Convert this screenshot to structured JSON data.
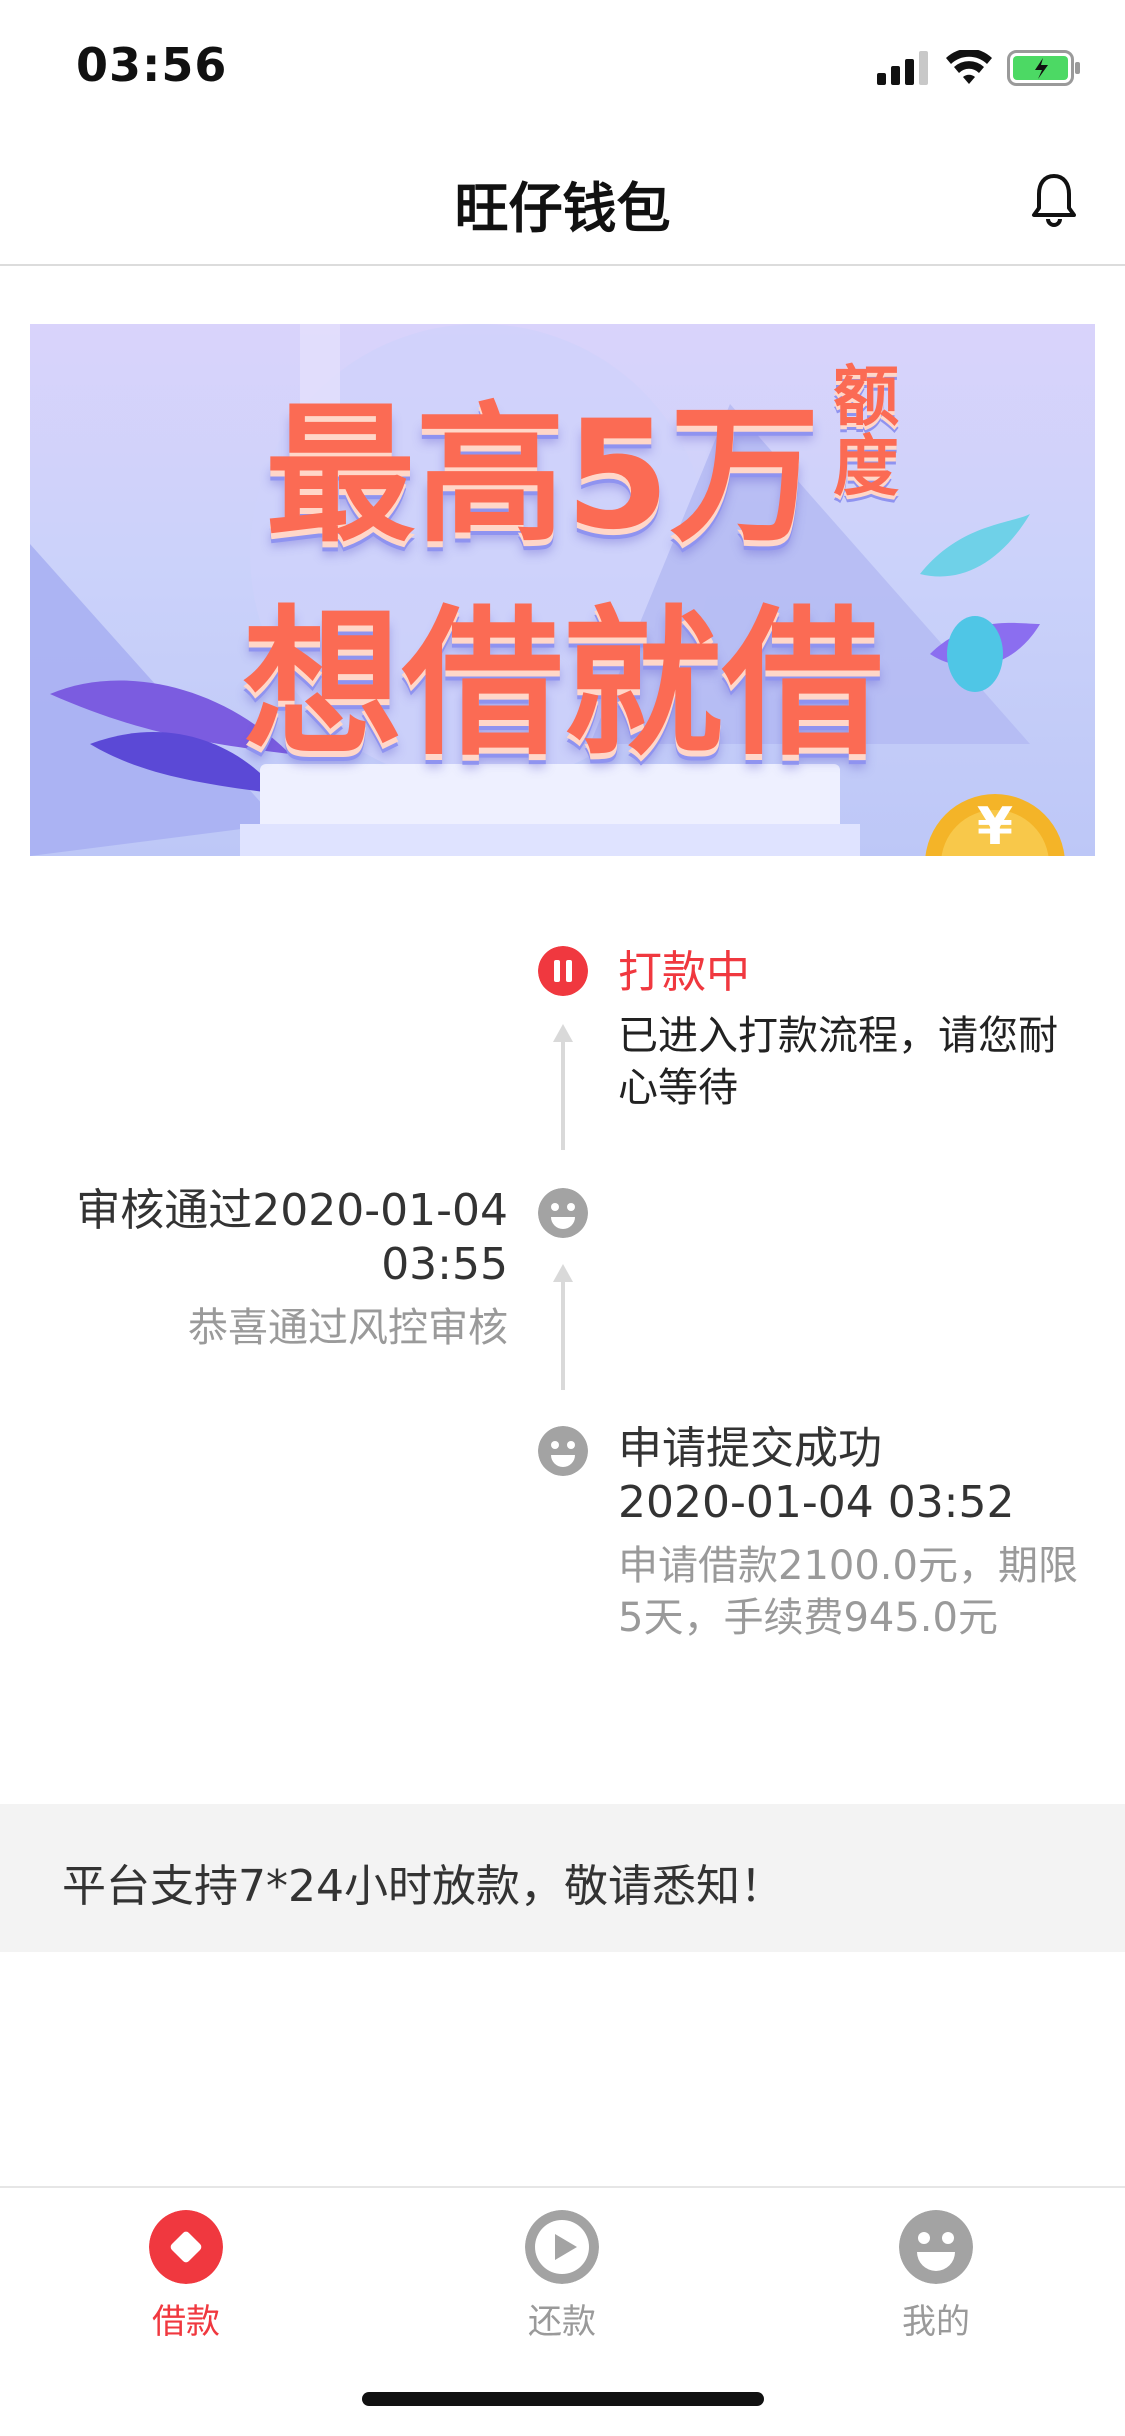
{
  "status_bar": {
    "time": "03:56"
  },
  "header": {
    "title": "旺仔钱包"
  },
  "banner": {
    "line1": "最高5万",
    "line1_side": "额度",
    "line2": "想借就借",
    "accent_color": "#fb6b54"
  },
  "timeline": {
    "step_paying": {
      "title": "打款中",
      "desc": "已进入打款流程，请您耐心等待",
      "icon": "pause-icon",
      "color": "#f0383f"
    },
    "step_review": {
      "title": "审核通过2020-01-04 03:55",
      "desc": "恭喜通过风控审核",
      "icon": "smiley-icon"
    },
    "step_submit": {
      "title": "申请提交成功",
      "time": "2020-01-04 03:52",
      "desc": "申请借款2100.0元，期限5天，手续费945.0元",
      "icon": "smiley-icon"
    }
  },
  "notice": {
    "text": "平台支持7*24小时放款，敬请悉知！"
  },
  "tab_bar": {
    "tabs": [
      {
        "label": "借款",
        "icon": "diamond-icon",
        "active": true
      },
      {
        "label": "还款",
        "icon": "play-icon",
        "active": false
      },
      {
        "label": "我的",
        "icon": "smiley-icon",
        "active": false
      }
    ],
    "active_color": "#f0383f",
    "inactive_color": "#9a9a9a"
  }
}
